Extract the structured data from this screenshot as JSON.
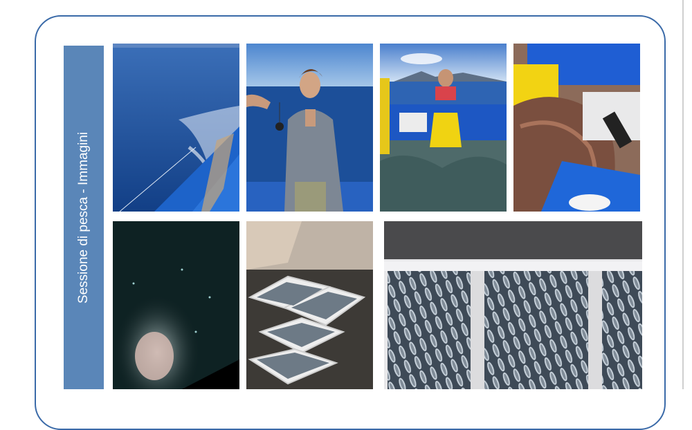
{
  "sidebar": {
    "title": "Sessione di pesca - Immagini"
  },
  "photos": [
    {
      "icon": "sea-boat-wake-photo"
    },
    {
      "icon": "fisherman-portrait-photo"
    },
    {
      "icon": "fisherman-nets-photo"
    },
    {
      "icon": "nets-on-deck-photo"
    },
    {
      "icon": "night-fishing-photo"
    },
    {
      "icon": "fish-crates-photo"
    },
    {
      "icon": "anchovy-crates-photo"
    }
  ],
  "colors": {
    "sidebar": "#5a86b8",
    "border": "#3a6aa8",
    "sea": "#1f4f9a",
    "boat": "#1e5fc8"
  }
}
